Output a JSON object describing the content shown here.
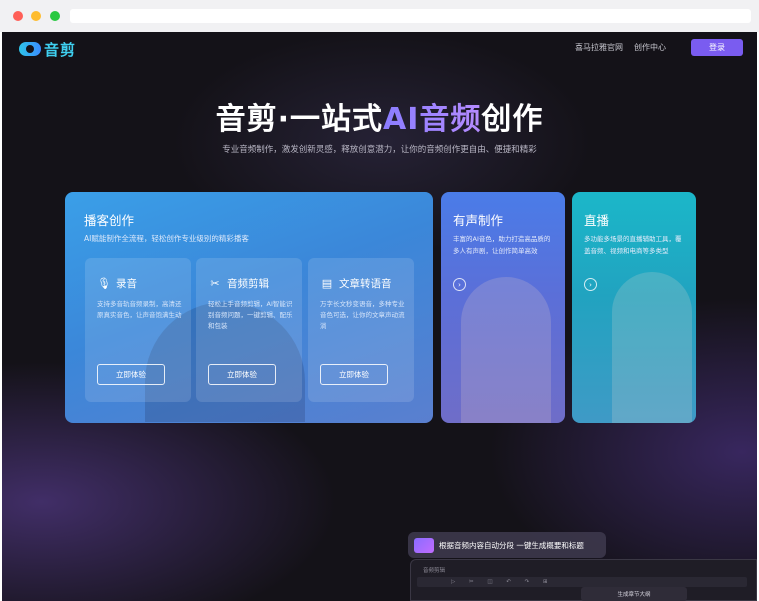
{
  "header": {
    "logo_text": "音剪",
    "nav": [
      "喜马拉雅官网",
      "创作中心"
    ],
    "login_label": "登录"
  },
  "hero": {
    "title_prefix": "音剪·一站式",
    "title_accent": "AI音频",
    "title_suffix": "创作",
    "subtitle": "专业音频制作，激发创新灵感，释放创意潜力，让你的音频创作更自由、便捷和精彩"
  },
  "podcast": {
    "title": "播客创作",
    "subtitle": "AI赋能制作全流程，轻松创作专业级别的精彩播客",
    "features": [
      {
        "icon": "microphone-icon",
        "name": "录音",
        "desc": "支持多音轨音频录制，高清还原真实音色，让声音饱满生动",
        "button": "立即体验"
      },
      {
        "icon": "scissors-icon",
        "name": "音频剪辑",
        "desc": "轻松上手音频剪辑，AI智能识别音频问题，一键剪辑、配乐和包装",
        "button": "立即体验"
      },
      {
        "icon": "text-to-speech-icon",
        "name": "文章转语音",
        "desc": "万字长文秒变语音，多种专业音色可选，让你的文章声动流淌",
        "button": "立即体验"
      }
    ]
  },
  "side_cards": [
    {
      "title": "有声制作",
      "desc": "丰富的AI音色，助力打造高品质的多人有声剧，让创作简单高效"
    },
    {
      "title": "直播",
      "desc": "多功能多场景的直播辅助工具，覆盖音频、视频和电商等多类型"
    }
  ],
  "bottom": {
    "annotation": "根据音频内容自动分段 一键生成概要和标题",
    "app_label": "音频剪辑",
    "popup_label": "生成章节大纲"
  },
  "colors": {
    "background": "#141218",
    "login": "#7a5cf0",
    "podcast_card": "#3a9fe8",
    "voice_card": "#4a7ce8",
    "live_card": "#1bb7c9"
  }
}
